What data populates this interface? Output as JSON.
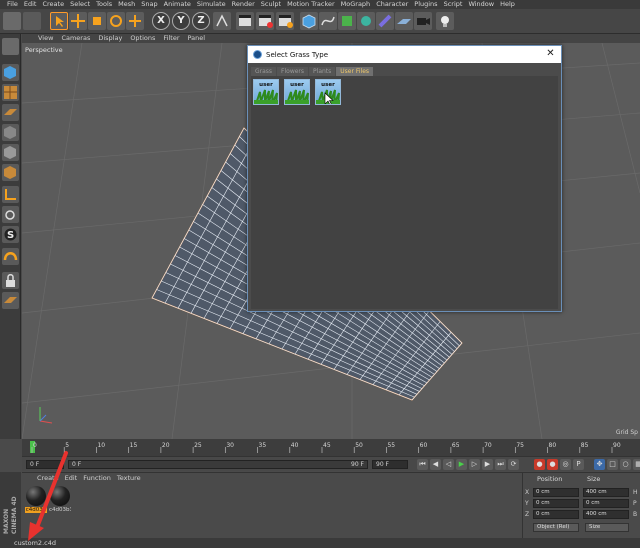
{
  "menubar": [
    "File",
    "Edit",
    "Create",
    "Select",
    "Tools",
    "Mesh",
    "Snap",
    "Animate",
    "Simulate",
    "Render",
    "Sculpt",
    "Motion Tracker",
    "MoGraph",
    "Character",
    "Plugins",
    "Script",
    "Window",
    "Help"
  ],
  "viewport": {
    "menu": [
      "View",
      "Cameras",
      "Display",
      "Options",
      "Filter",
      "Panel"
    ],
    "label": "Perspective",
    "grid_label": "Grid Sp"
  },
  "dialog": {
    "title": "Select Grass Type",
    "close": "✕",
    "tabs": [
      {
        "label": "Grass",
        "active": false
      },
      {
        "label": "Flowers",
        "active": false
      },
      {
        "label": "Plants",
        "active": false
      },
      {
        "label": "User Files",
        "active": true
      }
    ],
    "thumbs": [
      "user",
      "user",
      "user"
    ]
  },
  "timeline": {
    "ticks": [
      "0",
      "5",
      "10",
      "15",
      "20",
      "25",
      "30",
      "35",
      "40",
      "45",
      "50",
      "55",
      "60",
      "65",
      "70",
      "75",
      "80",
      "85",
      "90"
    ],
    "current_frame": "0 F",
    "start_frame": "0 F",
    "end_frame_bar": "90 F",
    "end_frame": "90 F"
  },
  "materials": {
    "menu": [
      "Create",
      "Edit",
      "Function",
      "Texture"
    ],
    "items": [
      {
        "label": "c4d03b",
        "selected": true
      },
      {
        "label": "c4d03b3",
        "selected": false
      }
    ]
  },
  "brand": {
    "line1": "MAXON",
    "line2": "CINEMA 4D"
  },
  "coords": {
    "headers": [
      "Position",
      "Size"
    ],
    "rows": [
      {
        "axis": "X",
        "pos": "0 cm",
        "size": "400 cm",
        "rot": "H"
      },
      {
        "axis": "Y",
        "pos": "0 cm",
        "size": "0 cm",
        "rot": "P"
      },
      {
        "axis": "Z",
        "pos": "0 cm",
        "size": "400 cm",
        "rot": "B"
      }
    ],
    "mode_left": "Object (Rel)",
    "mode_right": "Size"
  },
  "status": {
    "file": "custom2.c4d"
  },
  "colors": {
    "accent_orange": "#f0a020",
    "annotation_red": "#e8322e",
    "tab_active": "#f0c96a",
    "dialog_border": "#6a8fb8"
  }
}
